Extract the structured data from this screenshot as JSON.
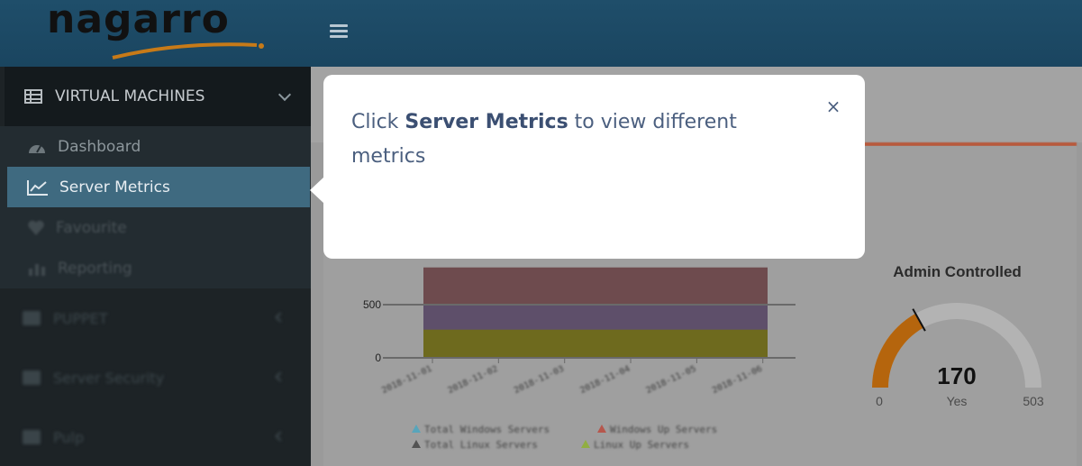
{
  "header": {
    "logo_text": "nagarro",
    "menu_toggle_icon": "hamburger-icon"
  },
  "sidebar": {
    "section_title": "VIRTUAL MACHINES",
    "section_icon": "table-icon",
    "submenu": [
      {
        "label": "Dashboard",
        "icon": "dashboard-icon",
        "active": false
      },
      {
        "label": "Server Metrics",
        "icon": "line-chart-icon",
        "active": true
      },
      {
        "label": "Favourite",
        "icon": "heart-icon",
        "active": false
      },
      {
        "label": "Reporting",
        "icon": "bar-chart-icon",
        "active": false
      }
    ],
    "menu": [
      {
        "label": "PUPPET"
      },
      {
        "label": "Server Security"
      },
      {
        "label": "Pulp"
      }
    ]
  },
  "popover": {
    "text_before": "Click ",
    "text_bold": "Server Metrics",
    "text_after": " to view different metrics",
    "close_label": "×"
  },
  "chart_data": [
    {
      "type": "area",
      "x": [
        "2018-11-01",
        "2018-11-02",
        "2018-11-03",
        "2018-11-04",
        "2018-11-05",
        "2018-11-06"
      ],
      "yticks": [
        "0",
        "500"
      ],
      "ylim": [
        0,
        1000
      ],
      "series": [
        {
          "name": "Total Windows Servers",
          "color": "#3aa8c8"
        },
        {
          "name": "Windows Up Servers",
          "color": "#c0392b"
        },
        {
          "name": "Total Linux Servers",
          "color": "#333333"
        },
        {
          "name": "Linux Up Servers",
          "color": "#8bb51a"
        }
      ],
      "layers": [
        {
          "color": "#6e6a1e",
          "value": 265
        },
        {
          "color": "#5e4f6a",
          "value": 505
        },
        {
          "color": "#6e4b4e",
          "value": 850
        }
      ]
    },
    {
      "type": "gauge",
      "title": "Admin Controlled",
      "value": 170,
      "min": 0,
      "max": 503,
      "label": "Yes",
      "min_label": "0",
      "max_label": "503",
      "value_label": "170"
    }
  ],
  "colors": {
    "popover_text": "#4b5f7f",
    "active_item": "#3f6a80",
    "header": "#1f4e6a",
    "gauge_fill": "#b5650d"
  }
}
